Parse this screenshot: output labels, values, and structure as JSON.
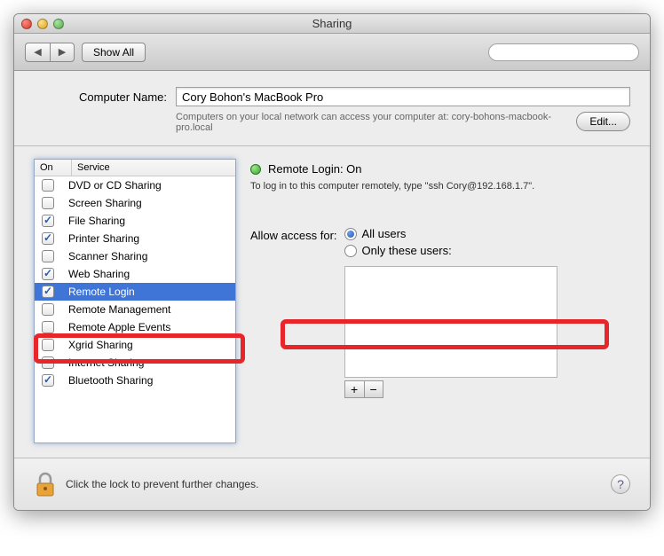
{
  "window": {
    "title": "Sharing"
  },
  "toolbar": {
    "show_all": "Show All",
    "search_placeholder": ""
  },
  "computer_name": {
    "label": "Computer Name:",
    "value": "Cory Bohon's MacBook Pro",
    "sub": "Computers on your local network can access your computer at: cory-bohons-macbook-pro.local",
    "edit": "Edit..."
  },
  "list_headers": {
    "on": "On",
    "service": "Service"
  },
  "services": [
    {
      "name": "DVD or CD Sharing",
      "on": false,
      "selected": false
    },
    {
      "name": "Screen Sharing",
      "on": false,
      "selected": false
    },
    {
      "name": "File Sharing",
      "on": true,
      "selected": false
    },
    {
      "name": "Printer Sharing",
      "on": true,
      "selected": false
    },
    {
      "name": "Scanner Sharing",
      "on": false,
      "selected": false
    },
    {
      "name": "Web Sharing",
      "on": true,
      "selected": false
    },
    {
      "name": "Remote Login",
      "on": true,
      "selected": true
    },
    {
      "name": "Remote Management",
      "on": false,
      "selected": false
    },
    {
      "name": "Remote Apple Events",
      "on": false,
      "selected": false
    },
    {
      "name": "Xgrid Sharing",
      "on": false,
      "selected": false
    },
    {
      "name": "Internet Sharing",
      "on": false,
      "selected": false
    },
    {
      "name": "Bluetooth Sharing",
      "on": true,
      "selected": false
    }
  ],
  "status": {
    "label": "Remote Login: On"
  },
  "instructions": "To log in to this computer remotely, type \"ssh Cory@192.168.1.7\".",
  "access": {
    "label": "Allow access for:",
    "opt_all": "All users",
    "opt_only": "Only these users:"
  },
  "footer": {
    "text": "Click the lock to prevent further changes."
  }
}
